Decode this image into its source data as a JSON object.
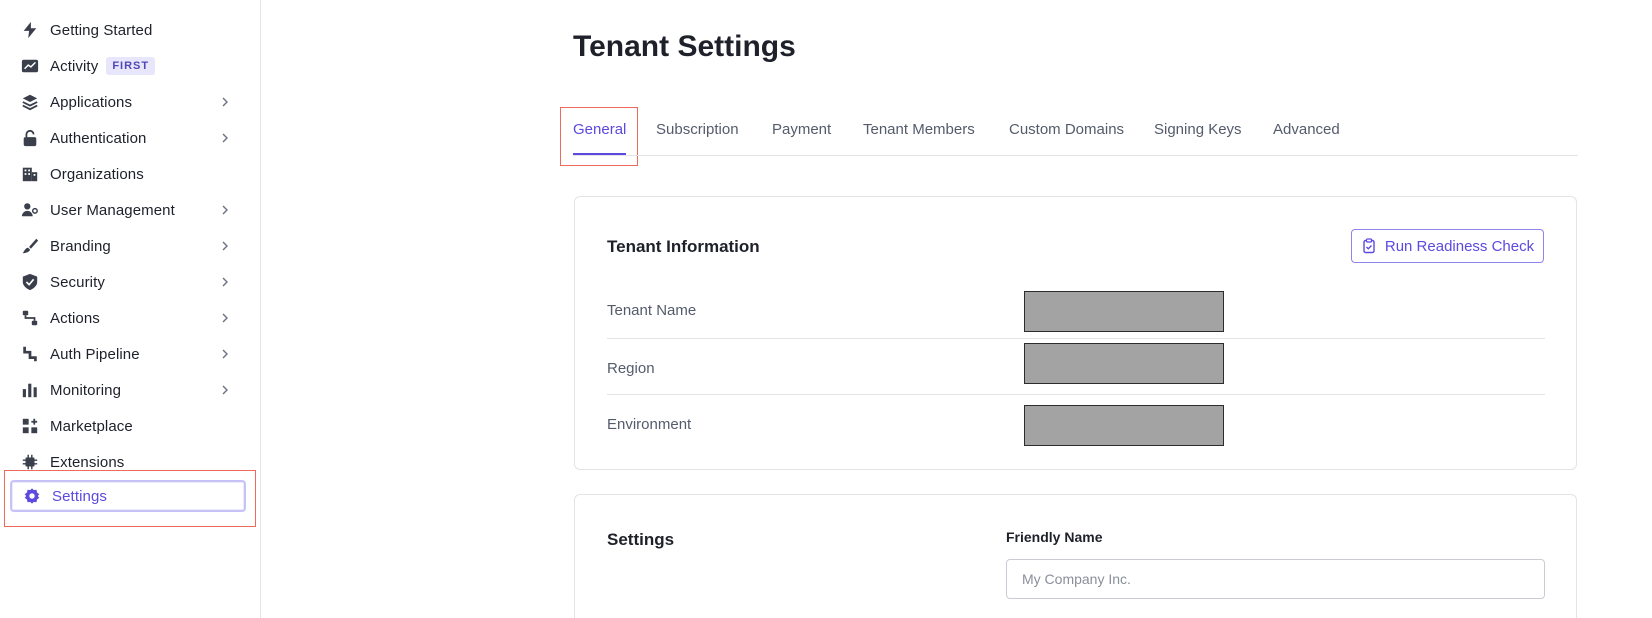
{
  "sidebar": {
    "items": [
      {
        "label": "Getting Started",
        "icon": "lightning-icon",
        "chevron": false
      },
      {
        "label": "Activity",
        "icon": "activity-chart-icon",
        "chevron": false,
        "badge": "FIRST"
      },
      {
        "label": "Applications",
        "icon": "layers-icon",
        "chevron": true
      },
      {
        "label": "Authentication",
        "icon": "lock-icon",
        "chevron": true
      },
      {
        "label": "Organizations",
        "icon": "building-icon",
        "chevron": false
      },
      {
        "label": "User Management",
        "icon": "users-gear-icon",
        "chevron": true
      },
      {
        "label": "Branding",
        "icon": "brush-icon",
        "chevron": true
      },
      {
        "label": "Security",
        "icon": "shield-check-icon",
        "chevron": true
      },
      {
        "label": "Actions",
        "icon": "flow-icon",
        "chevron": true
      },
      {
        "label": "Auth Pipeline",
        "icon": "pipeline-icon",
        "chevron": true
      },
      {
        "label": "Monitoring",
        "icon": "bar-chart-icon",
        "chevron": true
      },
      {
        "label": "Marketplace",
        "icon": "grid-plus-icon",
        "chevron": false
      },
      {
        "label": "Extensions",
        "icon": "chip-icon",
        "chevron": false
      },
      {
        "label": "Settings",
        "icon": "gear-icon",
        "chevron": false,
        "active": true
      }
    ]
  },
  "main": {
    "title": "Tenant Settings",
    "tabs": [
      {
        "label": "General",
        "active": true
      },
      {
        "label": "Subscription"
      },
      {
        "label": "Payment"
      },
      {
        "label": "Tenant Members"
      },
      {
        "label": "Custom Domains"
      },
      {
        "label": "Signing Keys"
      },
      {
        "label": "Advanced"
      }
    ],
    "tenant_info": {
      "title": "Tenant Information",
      "readiness_button": "Run Readiness Check",
      "rows": [
        {
          "label": "Tenant Name"
        },
        {
          "label": "Region"
        },
        {
          "label": "Environment"
        }
      ]
    },
    "settings": {
      "title": "Settings",
      "friendly_name_label": "Friendly Name",
      "friendly_name_placeholder": "My Company Inc.",
      "friendly_name_value": ""
    }
  },
  "colors": {
    "accent": "#5c49e0",
    "highlight": "#ee6a5a",
    "redaction": "#a3a3a3"
  }
}
